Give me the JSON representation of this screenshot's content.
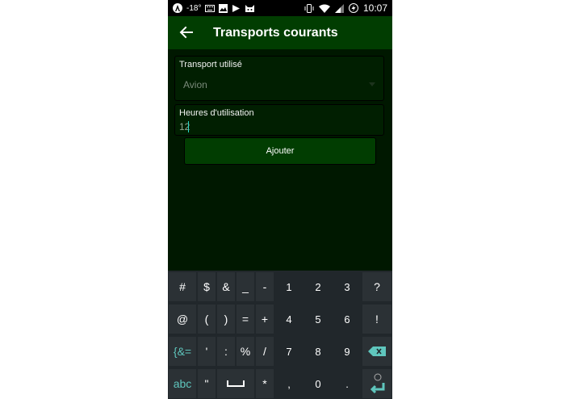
{
  "statusbar": {
    "temperature": "-18°",
    "time": "10:07",
    "left_icons": [
      "android-icon",
      "keyboard-icon",
      "image-icon",
      "play-store-icon",
      "cat-icon"
    ],
    "right_icons": [
      "vibrate-icon",
      "wifi-icon",
      "signal-icon",
      "battery-charging-icon"
    ]
  },
  "appbar": {
    "title": "Transports courants",
    "back_icon": "arrow-left-icon"
  },
  "form": {
    "transport_label": "Transport utilisé",
    "transport_value": "Avion",
    "hours_label": "Heures d'utilisation",
    "hours_value": "12",
    "add_button": "Ajouter"
  },
  "keyboard": {
    "row1": [
      "#",
      "$",
      "&",
      "_",
      "-",
      "1",
      "2",
      "3",
      "?"
    ],
    "row2": [
      "@",
      "(",
      ")",
      "=",
      "+",
      "4",
      "5",
      "6",
      "!"
    ],
    "row3": [
      "{&=",
      "'",
      ":",
      "%",
      "/",
      "7",
      "8",
      "9",
      "backspace-icon"
    ],
    "row4": [
      "abc",
      "\"",
      "space-icon",
      "*",
      ",",
      "0",
      ".",
      "emoji-enter-icon"
    ]
  },
  "colors": {
    "background": "#001800",
    "appbar": "#013d01",
    "accent": "#5fc6bd",
    "keyboard": "#21272b"
  }
}
